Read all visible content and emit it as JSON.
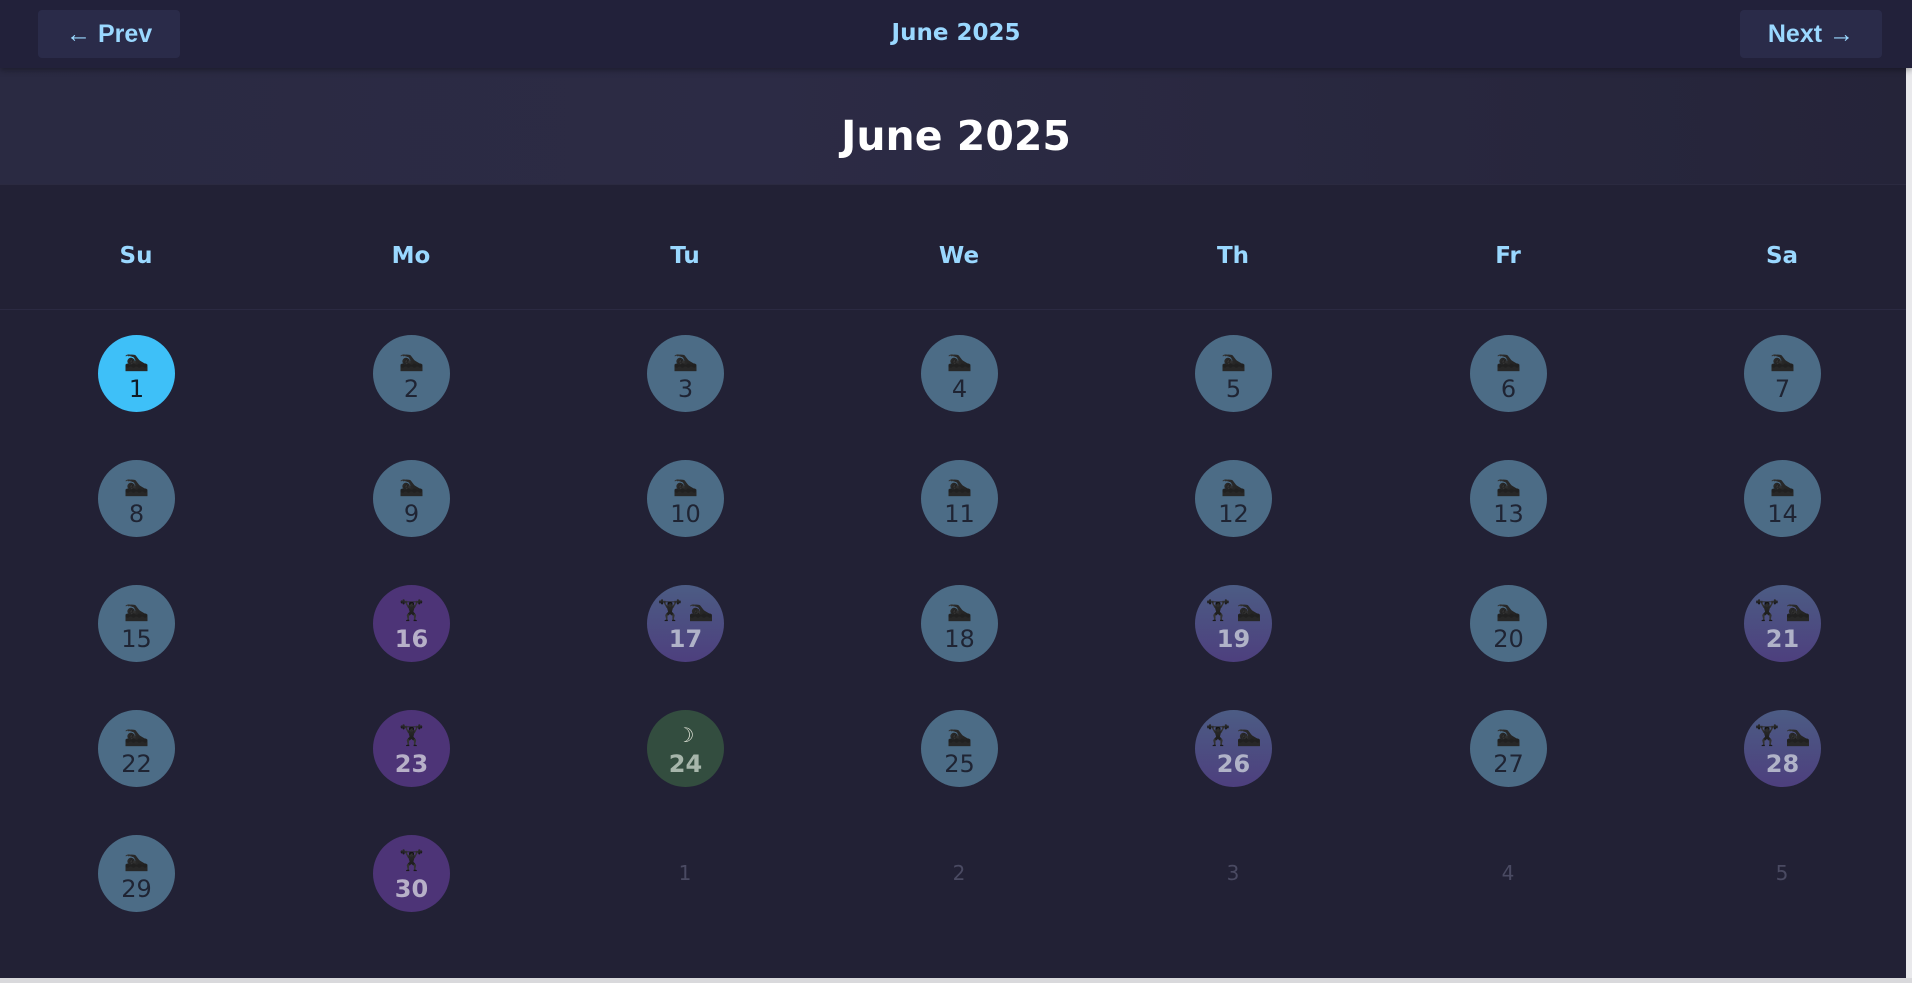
{
  "topbar": {
    "prev_label": "← Prev",
    "next_label": "Next →",
    "title": "June 2025"
  },
  "banner": {
    "title": "June 2025"
  },
  "weekdays": [
    "Su",
    "Mo",
    "Tu",
    "We",
    "Th",
    "Fr",
    "Sa"
  ],
  "icons": {
    "swim": "🏊",
    "lift": "🏋",
    "rest": "☽"
  },
  "colors": {
    "accent": "#9ad8ff",
    "today": "#3ec0f8",
    "swim": "#4c6c86",
    "lift": "#4d3477",
    "both": "#4d4a82",
    "rest": "#334d3f",
    "background": "#222135"
  },
  "days": [
    {
      "num": "1",
      "type": "today",
      "icons": "swim-icon"
    },
    {
      "num": "2",
      "type": "swim",
      "icons": "swim-icon"
    },
    {
      "num": "3",
      "type": "swim",
      "icons": "swim-icon"
    },
    {
      "num": "4",
      "type": "swim",
      "icons": "swim-icon"
    },
    {
      "num": "5",
      "type": "swim",
      "icons": "swim-icon"
    },
    {
      "num": "6",
      "type": "swim",
      "icons": "swim-icon"
    },
    {
      "num": "7",
      "type": "swim",
      "icons": "swim-icon"
    },
    {
      "num": "8",
      "type": "swim",
      "icons": "swim-icon"
    },
    {
      "num": "9",
      "type": "swim",
      "icons": "swim-icon"
    },
    {
      "num": "10",
      "type": "swim",
      "icons": "swim-icon"
    },
    {
      "num": "11",
      "type": "swim",
      "icons": "swim-icon"
    },
    {
      "num": "12",
      "type": "swim",
      "icons": "swim-icon"
    },
    {
      "num": "13",
      "type": "swim",
      "icons": "swim-icon"
    },
    {
      "num": "14",
      "type": "swim",
      "icons": "swim-icon"
    },
    {
      "num": "15",
      "type": "swim",
      "icons": "swim-icon"
    },
    {
      "num": "16",
      "type": "lift",
      "icons": "dumbbell-icon"
    },
    {
      "num": "17",
      "type": "both",
      "icons": "dumbbell-icon swim-icon"
    },
    {
      "num": "18",
      "type": "swim",
      "icons": "swim-icon"
    },
    {
      "num": "19",
      "type": "both",
      "icons": "dumbbell-icon swim-icon"
    },
    {
      "num": "20",
      "type": "swim",
      "icons": "swim-icon"
    },
    {
      "num": "21",
      "type": "both",
      "icons": "dumbbell-icon swim-icon"
    },
    {
      "num": "22",
      "type": "swim",
      "icons": "swim-icon"
    },
    {
      "num": "23",
      "type": "lift",
      "icons": "dumbbell-icon"
    },
    {
      "num": "24",
      "type": "rest",
      "icons": "moon-icon"
    },
    {
      "num": "25",
      "type": "swim",
      "icons": "swim-icon"
    },
    {
      "num": "26",
      "type": "both",
      "icons": "dumbbell-icon swim-icon"
    },
    {
      "num": "27",
      "type": "swim",
      "icons": "swim-icon"
    },
    {
      "num": "28",
      "type": "both",
      "icons": "dumbbell-icon swim-icon"
    },
    {
      "num": "29",
      "type": "swim",
      "icons": "swim-icon"
    },
    {
      "num": "30",
      "type": "lift",
      "icons": "dumbbell-icon"
    }
  ],
  "trailing_days": [
    "1",
    "2",
    "3",
    "4",
    "5"
  ]
}
